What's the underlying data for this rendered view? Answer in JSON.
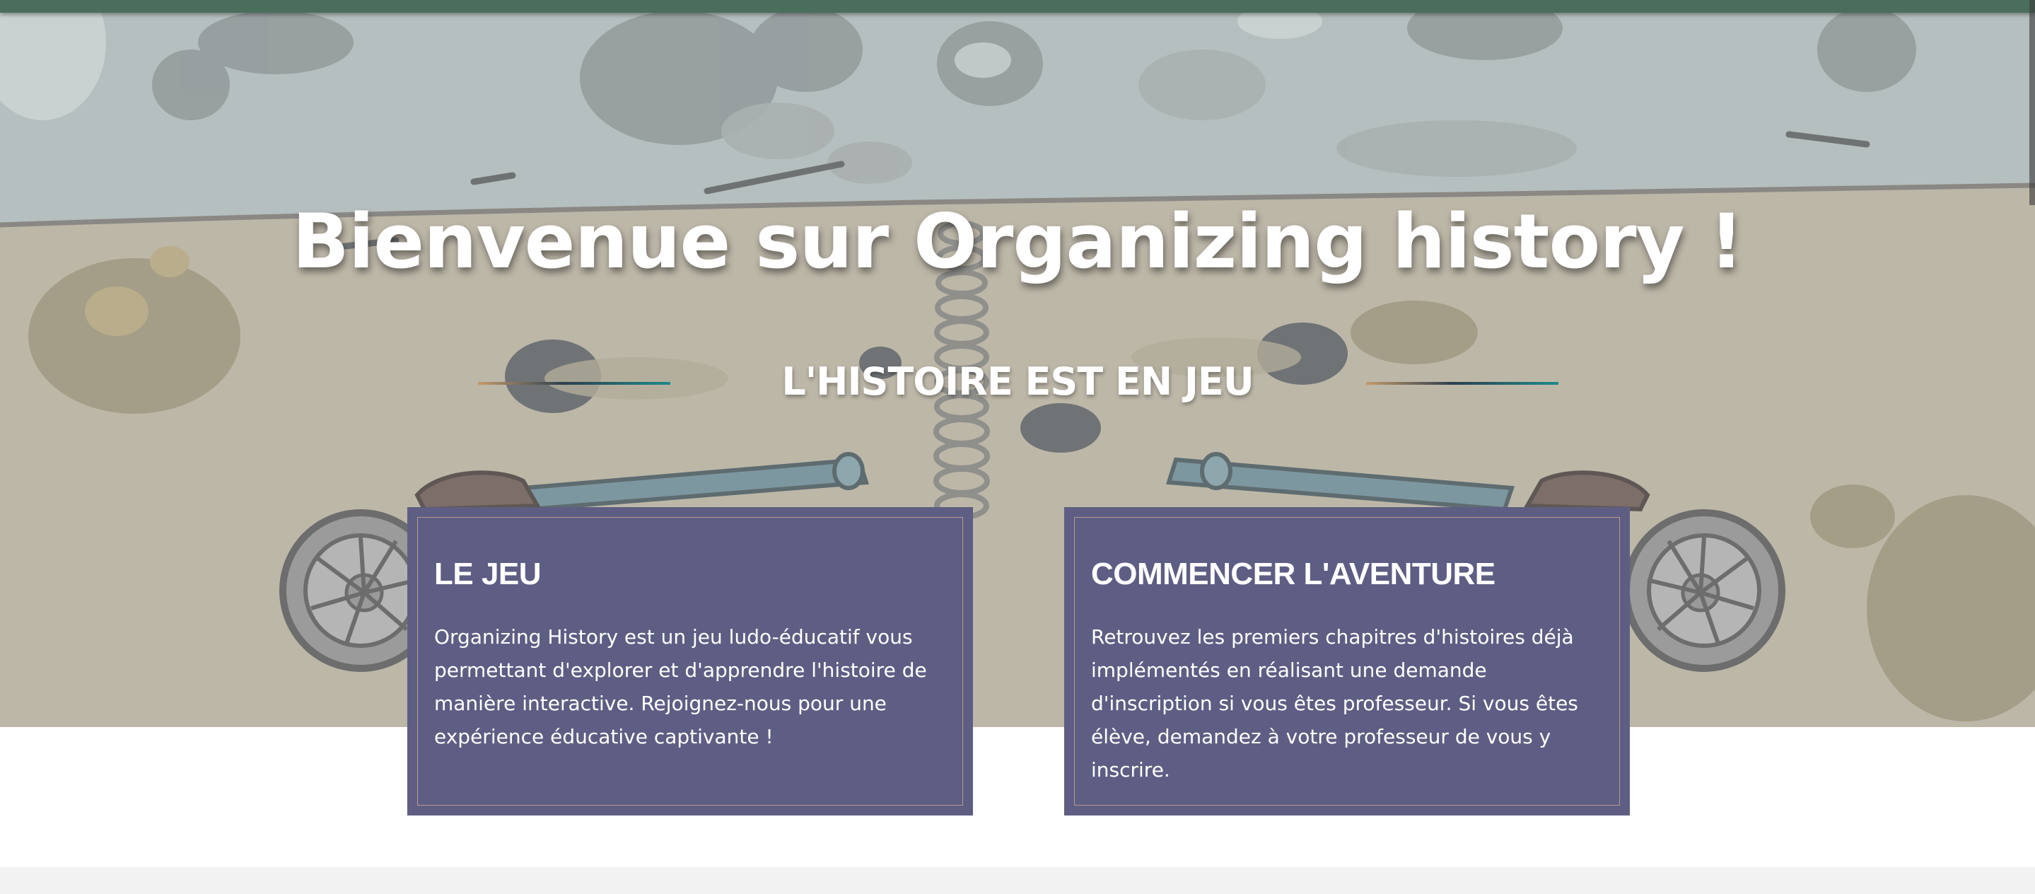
{
  "hero": {
    "title": "Bienvenue sur Organizing history !",
    "subtitle": "L'HISTOIRE EST EN JEU"
  },
  "cards": [
    {
      "title": "LE JEU",
      "text": "Organizing History est un jeu ludo-éducatif vous permettant d'explorer et d'apprendre l'histoire de manière interactive. Rejoignez-nous pour une expérience éducative captivante !"
    },
    {
      "title": "COMMENCER L'AVENTURE",
      "text": "Retrouvez les premiers chapitres d'histoires déjà implémentés en réalisant une demande d'inscription si vous êtes professeur. Si vous êtes élève, demandez à votre professeur de vous y inscrire."
    }
  ],
  "colors": {
    "topbar": "#4a6e5b",
    "card_background": "#5e5e84",
    "sky": "#b7c0c0",
    "ground": "#bdb7a8"
  },
  "icons": [
    "cannon-illustration",
    "spring-illustration"
  ]
}
